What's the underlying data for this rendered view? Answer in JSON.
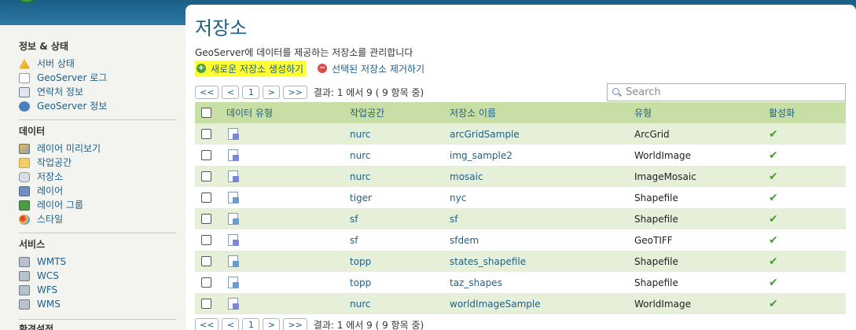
{
  "sidebar": {
    "sections": [
      {
        "title": "정보 & 상태",
        "items": [
          {
            "label": "서버 상태",
            "icon": "warning-icon"
          },
          {
            "label": "GeoServer 로그",
            "icon": "log-page-icon"
          },
          {
            "label": "연락처 정보",
            "icon": "contact-card-icon"
          },
          {
            "label": "GeoServer 정보",
            "icon": "info-icon"
          }
        ]
      },
      {
        "title": "데이터",
        "items": [
          {
            "label": "레이어 미리보기",
            "icon": "layer-preview-icon"
          },
          {
            "label": "작업공간",
            "icon": "folder-icon"
          },
          {
            "label": "저장소",
            "icon": "database-icon"
          },
          {
            "label": "레이어",
            "icon": "layer-icon"
          },
          {
            "label": "레이어 그룹",
            "icon": "layer-group-icon"
          },
          {
            "label": "스타일",
            "icon": "palette-icon"
          }
        ]
      },
      {
        "title": "서비스",
        "items": [
          {
            "label": "WMTS",
            "icon": "service-icon"
          },
          {
            "label": "WCS",
            "icon": "service-icon"
          },
          {
            "label": "WFS",
            "icon": "service-icon"
          },
          {
            "label": "WMS",
            "icon": "service-icon"
          }
        ]
      }
    ],
    "cut_off_title": "환경설정"
  },
  "main": {
    "title": "저장소",
    "description": "GeoServer에 데이터를 제공하는 저장소를 관리합니다",
    "actions": {
      "add_label": "새로운 저장소 생성하기",
      "remove_label": "선택된 저장소 제거하기"
    },
    "pager": {
      "first": "<<",
      "prev": "<",
      "page": "1",
      "next": ">",
      "last": ">>",
      "info": "결과: 1 에서 9 ( 9 항목 중)"
    },
    "search": {
      "placeholder": "Search",
      "value": ""
    },
    "table": {
      "headers": [
        "데이터 유형",
        "작업공간",
        "저장소 이름",
        "유형",
        "활성화"
      ],
      "rows": [
        {
          "workspace": "nurc",
          "name": "arcGridSample",
          "type": "ArcGrid",
          "enabled": "✔",
          "icon": "raster-store-icon"
        },
        {
          "workspace": "nurc",
          "name": "img_sample2",
          "type": "WorldImage",
          "enabled": "✔",
          "icon": "raster-store-icon"
        },
        {
          "workspace": "nurc",
          "name": "mosaic",
          "type": "ImageMosaic",
          "enabled": "✔",
          "icon": "raster-store-icon"
        },
        {
          "workspace": "tiger",
          "name": "nyc",
          "type": "Shapefile",
          "enabled": "✔",
          "icon": "vector-store-icon"
        },
        {
          "workspace": "sf",
          "name": "sf",
          "type": "Shapefile",
          "enabled": "✔",
          "icon": "vector-store-icon"
        },
        {
          "workspace": "sf",
          "name": "sfdem",
          "type": "GeoTIFF",
          "enabled": "✔",
          "icon": "raster-store-icon"
        },
        {
          "workspace": "topp",
          "name": "states_shapefile",
          "type": "Shapefile",
          "enabled": "✔",
          "icon": "vector-store-icon"
        },
        {
          "workspace": "topp",
          "name": "taz_shapes",
          "type": "Shapefile",
          "enabled": "✔",
          "icon": "vector-store-icon"
        },
        {
          "workspace": "nurc",
          "name": "worldImageSample",
          "type": "WorldImage",
          "enabled": "✔",
          "icon": "raster-store-icon"
        }
      ]
    }
  },
  "colors": {
    "link": "#1f5f86",
    "header_row": "#c7dea4",
    "odd_row": "#e6f0d8",
    "highlight": "#ffff33",
    "enabled_tick": "#4a9a3a"
  }
}
